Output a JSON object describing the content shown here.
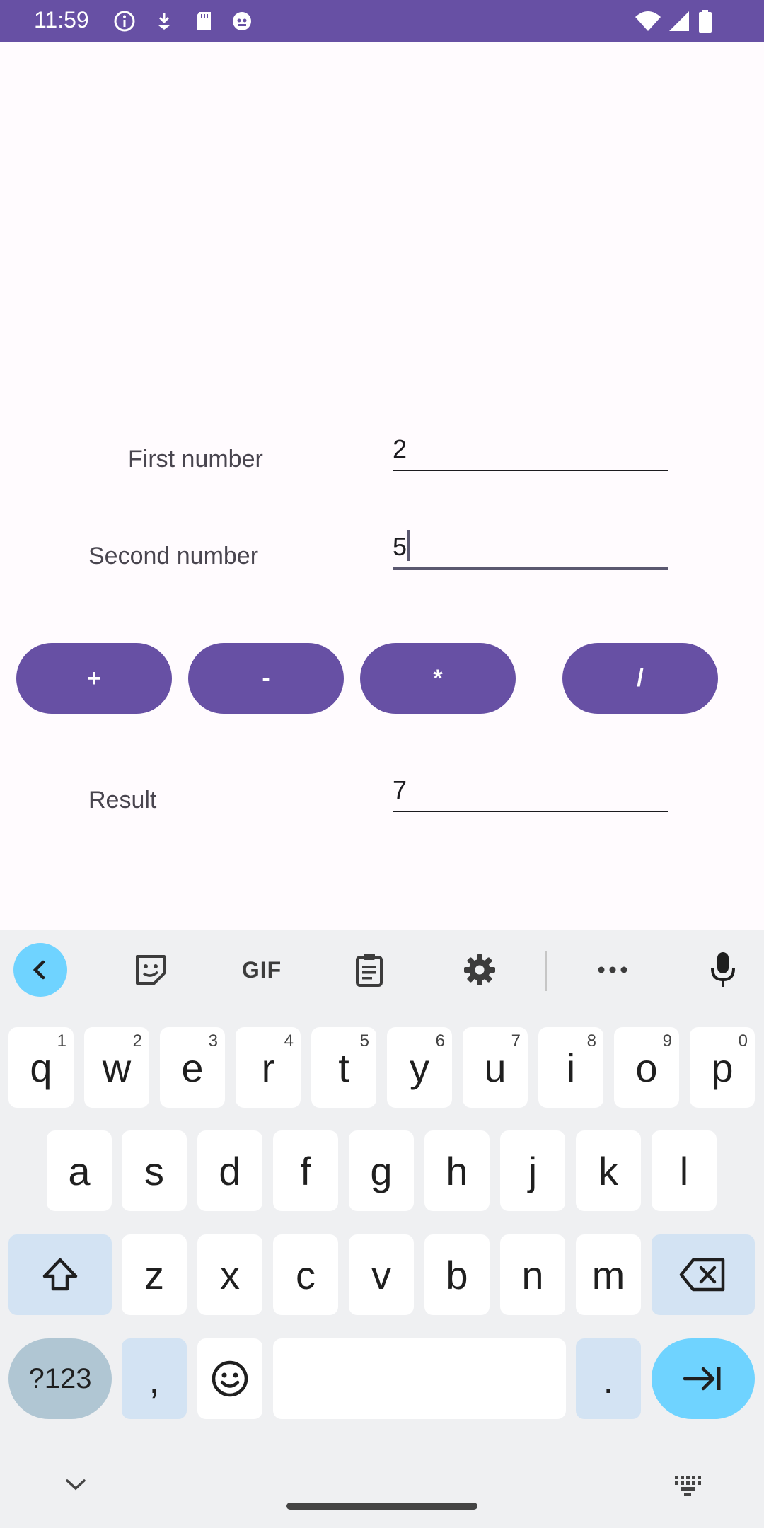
{
  "status_bar": {
    "time": "11:59",
    "background": "#6750a4",
    "left_icons": [
      "info-icon",
      "download-icon",
      "sd-card-icon",
      "debug-icon"
    ],
    "right_icons": [
      "wifi-icon",
      "signal-icon",
      "battery-icon"
    ]
  },
  "form": {
    "first_label": "First number",
    "first_value": "2",
    "second_label": "Second number",
    "second_value": "5",
    "result_label": "Result",
    "result_value": "7"
  },
  "operations": {
    "add": "+",
    "subtract": "-",
    "multiply": "*",
    "divide": "/"
  },
  "colors": {
    "accent": "#6750a4",
    "keyboard_bg": "#eff0f2",
    "key_mod": "#d3e3f3",
    "key_action": "#6fd3ff"
  },
  "keyboard": {
    "toolbar": [
      "back-icon",
      "sticker-icon",
      "gif-icon",
      "clipboard-icon",
      "settings-icon",
      "more-icon",
      "mic-icon"
    ],
    "gif_label": "GIF",
    "row1": [
      {
        "key": "q",
        "hint": "1"
      },
      {
        "key": "w",
        "hint": "2"
      },
      {
        "key": "e",
        "hint": "3"
      },
      {
        "key": "r",
        "hint": "4"
      },
      {
        "key": "t",
        "hint": "5"
      },
      {
        "key": "y",
        "hint": "6"
      },
      {
        "key": "u",
        "hint": "7"
      },
      {
        "key": "i",
        "hint": "8"
      },
      {
        "key": "o",
        "hint": "9"
      },
      {
        "key": "p",
        "hint": "0"
      }
    ],
    "row2": [
      "a",
      "s",
      "d",
      "f",
      "g",
      "h",
      "j",
      "k",
      "l"
    ],
    "row3": [
      "z",
      "x",
      "c",
      "v",
      "b",
      "n",
      "m"
    ],
    "symbols_label": "?123",
    "comma": ",",
    "period": ".",
    "emoji_icon": "emoji-icon",
    "shift_icon": "shift-icon",
    "backspace_icon": "backspace-icon",
    "next_icon": "tab-next-icon",
    "hide_icon": "chevron-down-icon",
    "switch_icon": "keyboard-icon"
  }
}
